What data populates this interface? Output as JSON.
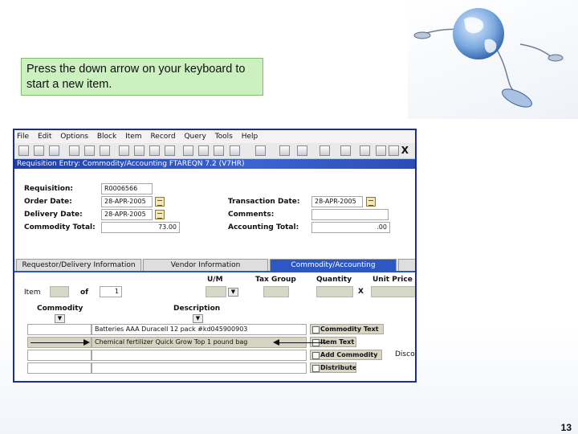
{
  "callout": {
    "text": "Press the down arrow on your keyboard to start a new item."
  },
  "slide": {
    "page_number": "13"
  },
  "app": {
    "menu": [
      "File",
      "Edit",
      "Options",
      "Block",
      "Item",
      "Record",
      "Query",
      "Tools",
      "Help"
    ],
    "close_label": "X",
    "title": "Requisition Entry: Commodity/Accounting  FTAREQN  7.2  (V7HR)",
    "header": {
      "requisition_label": "Requisition:",
      "requisition_value": "R0006566",
      "order_date_label": "Order Date:",
      "order_date_value": "28-APR-2005",
      "delivery_date_label": "Delivery Date:",
      "delivery_date_value": "28-APR-2005",
      "commodity_total_label": "Commodity Total:",
      "commodity_total_value": "73.00",
      "transaction_date_label": "Transaction Date:",
      "transaction_date_value": "28-APR-2005",
      "comments_label": "Comments:",
      "accounting_total_label": "Accounting Total:",
      "accounting_total_value": ".00"
    },
    "tabs": [
      "Requestor/Delivery Information",
      "Vendor Information",
      "Commodity/Accounting"
    ],
    "item_section": {
      "item_label": "Item",
      "of_label": "of",
      "of_value": "1",
      "um_label": "U/M",
      "tax_group_label": "Tax Group",
      "quantity_label": "Quantity",
      "unit_price_label": "Unit Price",
      "times_label": "X",
      "commodity_label": "Commodity",
      "description_label": "Description"
    },
    "rows": [
      {
        "description": "Batteries AAA Duracell 12 pack #kd045900903"
      },
      {
        "description": "Chemical fertilizer Quick Grow Top 1 pound bag"
      },
      {
        "description": ""
      },
      {
        "description": ""
      }
    ],
    "side_options": [
      "Commodity Text",
      "Item Text",
      "Add Commodity",
      "Distribute"
    ],
    "extra_label": "Disco"
  },
  "colors": {
    "accent": "#2e57c6",
    "callout_bg": "#ccf0c0",
    "frame": "#1b2f8a"
  },
  "icons": [
    "globe-icon",
    "computer-mouse-icon",
    "calendar-icon",
    "dropdown-arrow-icon",
    "checkbox-icon"
  ]
}
